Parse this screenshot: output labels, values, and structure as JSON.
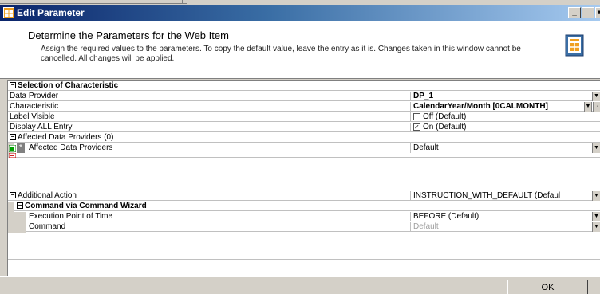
{
  "window": {
    "title": "Edit Parameter",
    "minimize_glyph": "_",
    "maximize_glyph": "□",
    "close_glyph": "x"
  },
  "header": {
    "heading": "Determine the Parameters for the Web Item",
    "description": "Assign the required values to the parameters. To copy the default value, leave the entry as it is. Changes taken in this window cannot be cancelled. All changes will be applied."
  },
  "section": {
    "title": "Selection of Characteristic"
  },
  "rows": {
    "data_provider": {
      "label": "Data Provider",
      "value": "DP_1"
    },
    "characteristic": {
      "label": "Characteristic",
      "value": "CalendarYear/Month [0CALMONTH]"
    },
    "label_visible": {
      "label": "Label Visible",
      "value": "Off (Default)",
      "checked": false
    },
    "display_all": {
      "label": "Display ALL Entry",
      "value": "On (Default)",
      "checked": true
    },
    "affected_group": {
      "label": "Affected Data Providers (0)"
    },
    "affected_item": {
      "marker": "*",
      "label": "Affected Data Providers",
      "value": "Default"
    },
    "additional_action": {
      "label": "Additional Action",
      "value": "INSTRUCTION_WITH_DEFAULT (Defaul"
    },
    "command_wizard": {
      "label": "Command via Command Wizard"
    },
    "execution_point": {
      "label": "Execution Point of Time",
      "value": "BEFORE (Default)"
    },
    "command": {
      "label": "Command",
      "value": "Default"
    }
  },
  "footer": {
    "ok_label": "OK"
  },
  "colors": {
    "title_start": "#0a246a",
    "title_end": "#a6caf0",
    "panel_bg": "#ffffff",
    "chrome": "#d4d0c8"
  }
}
